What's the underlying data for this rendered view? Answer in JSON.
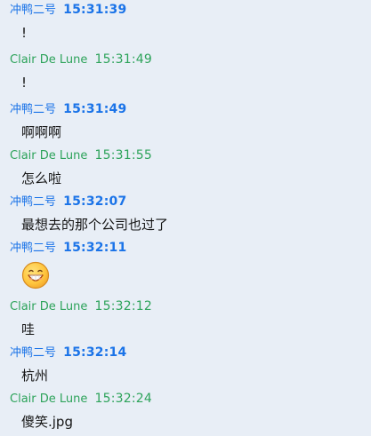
{
  "messages": [
    {
      "sender": "冲鸭二号",
      "time": "15:31:39",
      "text": "!"
    },
    {
      "sender": "Clair De Lune",
      "time": "15:31:49",
      "text": "!"
    },
    {
      "sender": "冲鸭二号",
      "time": "15:31:49",
      "text": "啊啊啊"
    },
    {
      "sender": "Clair De Lune",
      "time": "15:31:55",
      "text": "怎么啦"
    },
    {
      "sender": "冲鸭二号",
      "time": "15:32:07",
      "text": "最想去的那个公司也过了"
    },
    {
      "sender": "冲鸭二号",
      "time": "15:32:11",
      "icon": "grinning-face-icon"
    },
    {
      "sender": "Clair De Lune",
      "time": "15:32:12",
      "text": "哇"
    },
    {
      "sender": "冲鸭二号",
      "time": "15:32:14",
      "text": "杭州"
    },
    {
      "sender": "Clair De Lune",
      "time": "15:32:24",
      "text": "傻笑.jpg"
    }
  ],
  "colors": {
    "background": "#e8eef6",
    "blue_sender": "#1a73e8",
    "green_sender": "#2da35a",
    "text": "#151515"
  }
}
